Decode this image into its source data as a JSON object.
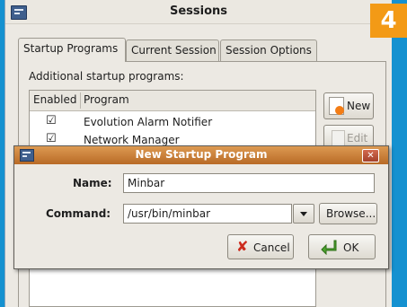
{
  "badge": "4",
  "window": {
    "title": "Sessions"
  },
  "tabs": [
    "Startup Programs",
    "Current Session",
    "Session Options"
  ],
  "startup": {
    "label": "Additional startup programs:",
    "columns": [
      "Enabled",
      "Program"
    ],
    "rows": [
      {
        "enabled": "☑",
        "program": "Evolution Alarm Notifier"
      },
      {
        "enabled": "☑",
        "program": "Network Manager"
      }
    ],
    "new_label": "New",
    "edit_label": "Edit"
  },
  "dialog": {
    "title": "New Startup Program",
    "name_label": "Name:",
    "name_value": "Minbar",
    "command_label": "Command:",
    "command_value": "/usr/bin/minbar",
    "browse_label": "Browse...",
    "cancel_label": "Cancel",
    "ok_label": "OK"
  },
  "colors": {
    "accent_badge": "#f39a16",
    "desktop": "#1591d0",
    "dialog_title": "#c27630"
  }
}
